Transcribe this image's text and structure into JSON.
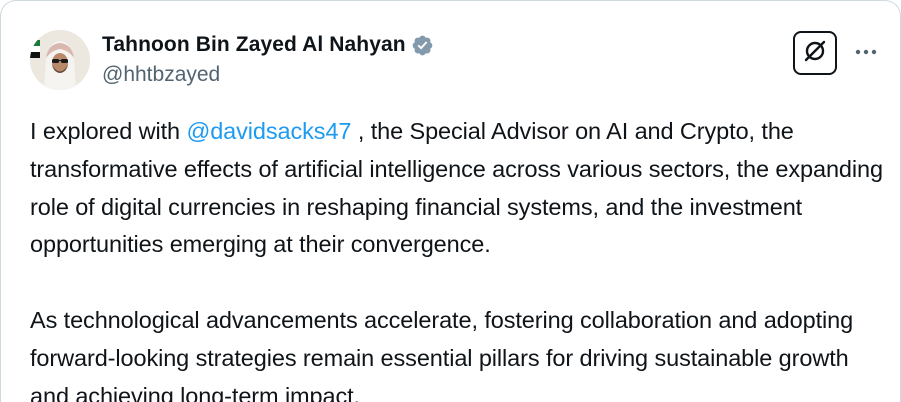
{
  "author": {
    "display_name": "Tahnoon Bin Zayed Al Nahyan",
    "handle": "@hhtbzayed",
    "verified": true,
    "verified_badge_color": "#829aab"
  },
  "header_actions": {
    "grok_icon": "grok-icon",
    "more_icon": "more-horizontal-icon"
  },
  "tweet": {
    "paragraph_1": {
      "before_mention": "I explored with ",
      "mention": "@davidsacks47",
      "after_mention": " , the Special Advisor on AI and Crypto, the transformative effects of artificial intelligence across various sectors, the expanding role of digital currencies in reshaping financial systems, and the investment opportunities emerging at their convergence."
    },
    "paragraph_2": "As technological advancements accelerate, fostering collaboration and adopting forward-looking strategies remain essential pillars for driving sustainable growth and achieving long-term impact."
  },
  "colors": {
    "text_primary": "#0f1419",
    "text_secondary": "#536471",
    "link": "#1d9bf0",
    "border": "#cfd9de"
  }
}
